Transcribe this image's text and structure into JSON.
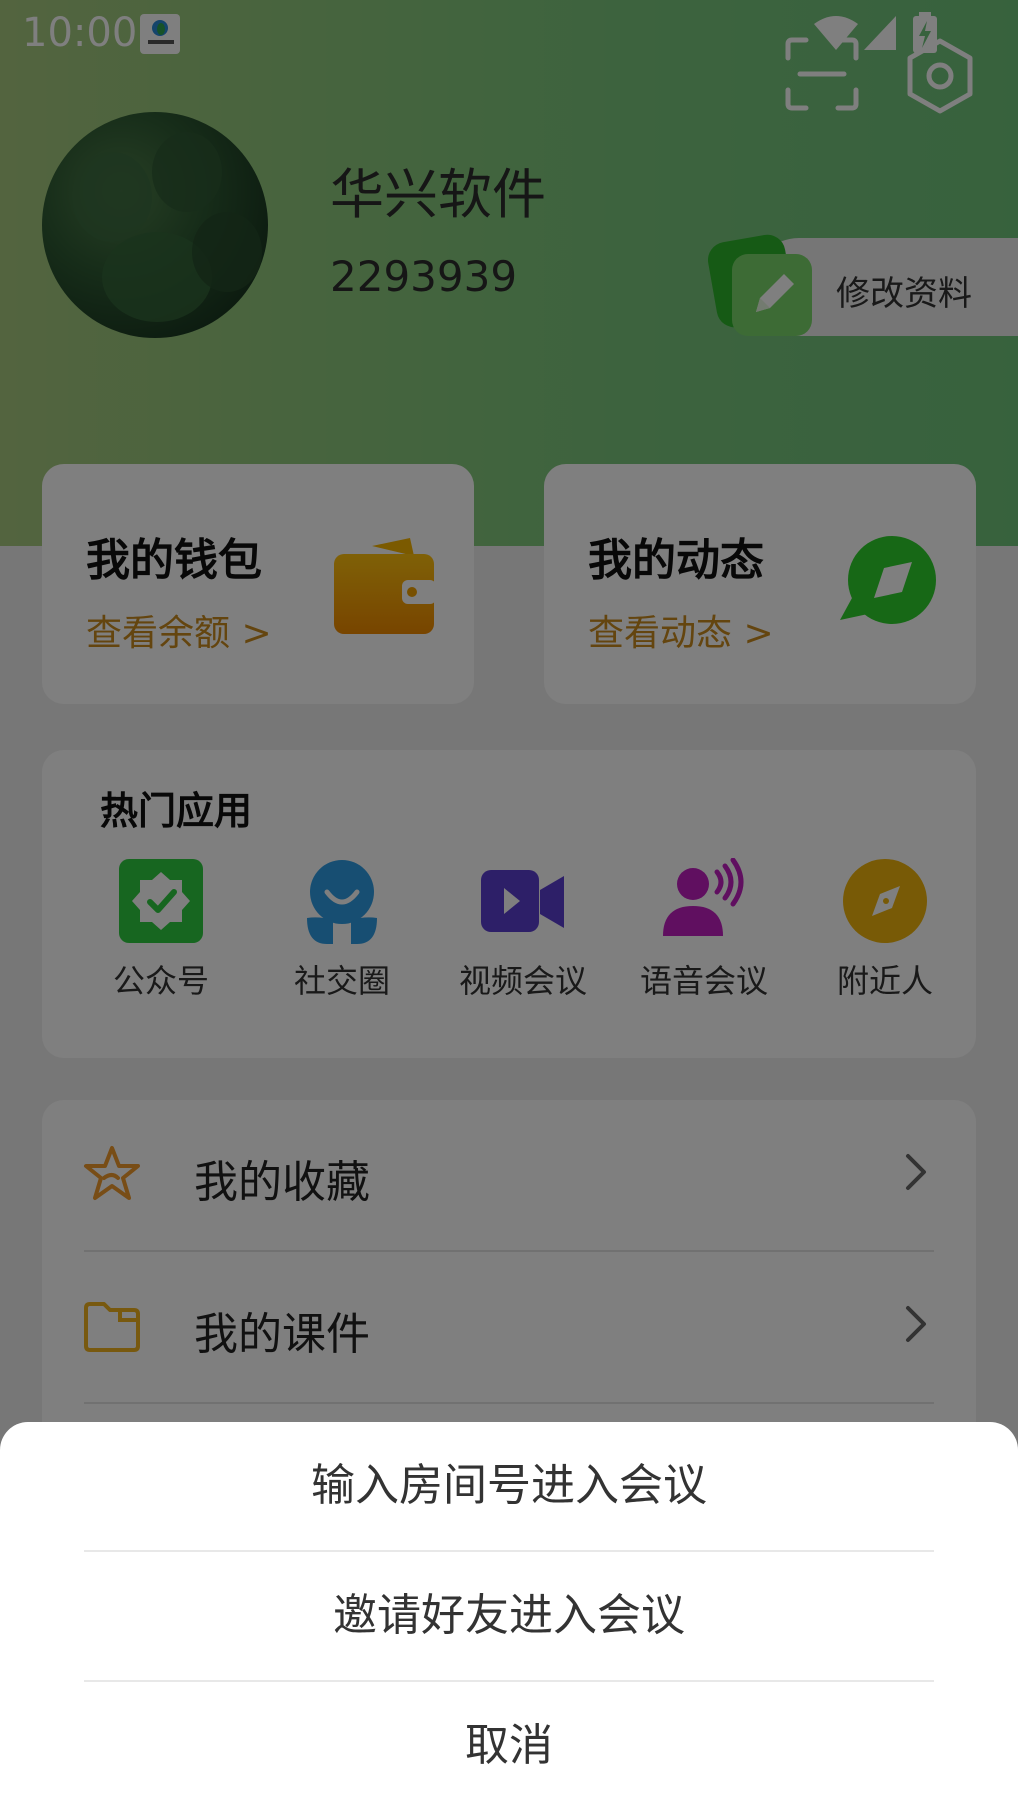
{
  "status_bar": {
    "time": "10:00"
  },
  "profile": {
    "name": "华兴软件",
    "id": "2293939",
    "edit_label": "修改资料"
  },
  "wallet": {
    "title": "我的钱包",
    "subtitle": "查看余额 >"
  },
  "moments": {
    "title": "我的动态",
    "subtitle": "查看动态 >"
  },
  "hot_apps": {
    "title": "热门应用",
    "items": [
      {
        "label": "公众号",
        "icon": "verified-badge-icon",
        "color": "#2ecc40"
      },
      {
        "label": "社交圈",
        "icon": "social-people-icon",
        "color": "#2f9de4"
      },
      {
        "label": "视频会议",
        "icon": "video-camera-icon",
        "color": "#5b3fd1"
      },
      {
        "label": "语音会议",
        "icon": "voice-person-icon",
        "color": "#c01fc0"
      },
      {
        "label": "附近人",
        "icon": "compass-icon",
        "color": "#f0b40c"
      }
    ]
  },
  "menu": {
    "items": [
      {
        "label": "我的收藏",
        "icon": "star-icon"
      },
      {
        "label": "我的课件",
        "icon": "folder-icon"
      }
    ]
  },
  "action_sheet": {
    "options": [
      "输入房间号进入会议",
      "邀请好友进入会议"
    ],
    "cancel": "取消"
  },
  "colors": {
    "header_gradient_start": "#a7c97e",
    "header_gradient_end": "#6fc47b",
    "accent_orange": "#c88a1e",
    "overlay": "rgba(0,0,0,0.5)"
  }
}
